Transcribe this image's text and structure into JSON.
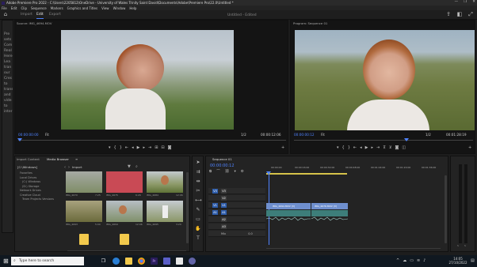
{
  "window": {
    "title": "Adobe Premiere Pro 2022 - C:\\Users\\2205812\\OneDrive - University of Wales Trinity Saint David\\Documents\\Adobe\\Premiere Pro\\22.0\\Untitled *",
    "minimize": "—",
    "maximize": "❐",
    "close": "✕"
  },
  "menu": [
    "File",
    "Edit",
    "Clip",
    "Sequence",
    "Markers",
    "Graphics and Titles",
    "View",
    "Window",
    "Help"
  ],
  "header": {
    "tabs": [
      {
        "label": "Import",
        "active": false
      },
      {
        "label": "Edit",
        "active": true
      },
      {
        "label": "Export",
        "active": false
      }
    ],
    "document": "Untitled - Edited"
  },
  "source_monitor": {
    "title": "Source: IMG_4694.MOV",
    "timecode_left": "00:00:00:00",
    "fit": "Fit",
    "resolution": "1/2",
    "timecode_right": "00:00:12:06"
  },
  "program_monitor": {
    "title": "Program: Sequence 01",
    "timecode_left": "00:00:00:12",
    "fit": "Fit",
    "resolution": "1/2",
    "timecode_right": "00:01:28:19"
  },
  "left_panel": {
    "lines": [
      "Pre",
      "sets",
      "",
      "Com",
      "Real",
      "Here",
      "",
      "",
      "Lea",
      "tran",
      "our",
      "Cres",
      "to",
      "trans",
      "and",
      "vide",
      "to",
      "inter"
    ]
  },
  "media_browser": {
    "tabs": [
      "Import Content",
      "Media Browser",
      "≡"
    ],
    "location": "[C:\\Windows]",
    "import_label": "Import",
    "tree": [
      "Favorites",
      "Local Drives",
      "(C:) Windows",
      "(D:) Storage",
      "Network Drives",
      "Creative Cloud",
      "Team Projects Versions"
    ],
    "thumbnails": [
      {
        "label": "IMG_4670",
        "dur": "7:25"
      },
      {
        "label": "IMG_4675",
        "dur": "6:26"
      },
      {
        "label": "IMG_4684",
        "dur": "12:06"
      },
      {
        "label": "IMG_4693",
        "dur": "5:00"
      },
      {
        "label": "IMG_4694",
        "dur": "12:06"
      },
      {
        "label": "IMG_4695",
        "dur": "3:29"
      },
      {
        "label": "",
        "dur": ""
      },
      {
        "label": "",
        "dur": ""
      }
    ]
  },
  "timeline": {
    "title": "Sequence 01",
    "timecode": "00:00:00:12",
    "ruler": [
      "00:00:00",
      "00:00:16:00",
      "00:00:32:00",
      "00:00:48:00",
      "00:01:04:00",
      "00:01:20:00",
      "00:01:36:00"
    ],
    "tracks": [
      "V3",
      "V2",
      "V1",
      "A1",
      "A2",
      "A3",
      "Mix"
    ],
    "mix_value": "0.0",
    "clips_video": [
      "IMG_4694.MOV [V]",
      "IMG_4676.MOV [V]"
    ],
    "clips_audio": [
      "",
      ""
    ]
  },
  "taskbar": {
    "search_placeholder": "Type here to search",
    "time": "14:05",
    "date": "27/10/2022"
  },
  "colors": {
    "accent": "#4f83ff",
    "video_clip": "#6f8fce",
    "audio_clip": "#3d7e7a"
  }
}
